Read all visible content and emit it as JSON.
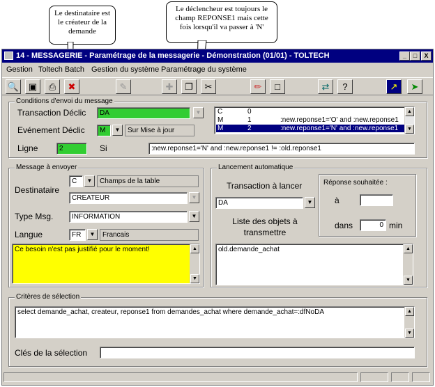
{
  "window": {
    "title": "14 - MESSAGERIE - Paramétrage de la messagerie - Démonstration (01/01) - TOLTECH",
    "minimize": "_",
    "restore": "□",
    "close": "X"
  },
  "menu": [
    "Gestion",
    "Toltech Batch",
    "Gestion du système",
    "Paramétrage du système"
  ],
  "toolbar": [
    "search-icon",
    "camera-icon",
    "print-icon",
    "delete-icon",
    "tool-disabled-icon",
    "add-disabled-icon",
    "copy-icon",
    "cut-icon",
    "eraser-icon",
    "new-page-icon",
    "swap-icon",
    "help-icon",
    "chart-icon",
    "exit-icon"
  ],
  "callouts": {
    "left": "Le destinataire est le créateur de la demande",
    "right": "Le déclencheur est toujours le champ REPONSE1 mais cette fois lorsqu'il va passer à 'N'"
  },
  "conditions": {
    "legend": "Conditions d'envoi du message",
    "transaction_label": "Transaction Déclic",
    "transaction_value": "DA",
    "event_label": "Evénement Déclic",
    "event_code": "M",
    "event_desc": "Sur Mise à jour",
    "line_label": "Ligne",
    "line_value": "2",
    "si_label": "Si",
    "si_value": ":new.reponse1='N' and :new.reponse1 != :old.reponse1",
    "rows": [
      {
        "c1": "C",
        "c2": "0",
        "c3": ""
      },
      {
        "c1": "M",
        "c2": "1",
        "c3": ":new.reponse1='O'  and :new.reponse1"
      },
      {
        "c1": "M",
        "c2": "2",
        "c3": ":new.reponse1='N' and :new.reponse1"
      }
    ]
  },
  "message": {
    "legend": "Message à envoyer",
    "dest_label": "Destinataire",
    "dest_code": "C",
    "dest_desc": "Champs de la table",
    "dest_value": "CREATEUR",
    "type_label": "Type Msg.",
    "type_value": "INFORMATION",
    "lang_label": "Langue",
    "lang_code": "FR",
    "lang_desc": "Francais",
    "text": "Ce besoin n'est pas justifié pour le moment!"
  },
  "launch": {
    "legend": "Lancement automatique",
    "trans_label": "Transaction à lancer",
    "trans_value": "DA",
    "objects_label": "Liste des objets à transmettre",
    "objects_value": "old.demande_achat",
    "reply_label": "Réponse souhaitée :",
    "a_label": "à",
    "a_value": "",
    "dans_label": "dans",
    "dans_value": "0",
    "min_label": "min"
  },
  "criteria": {
    "legend": "Critères de sélection",
    "sql": "select demande_achat, createur, reponse1 from demandes_achat where demande_achat=:dfNoDA",
    "keys_label": "Clés de la sélection",
    "keys_value": ""
  },
  "colors": {
    "title_bar": "#000080",
    "field_green": "#32cd32",
    "field_yellow": "#ffff00",
    "selection": "#000080"
  }
}
